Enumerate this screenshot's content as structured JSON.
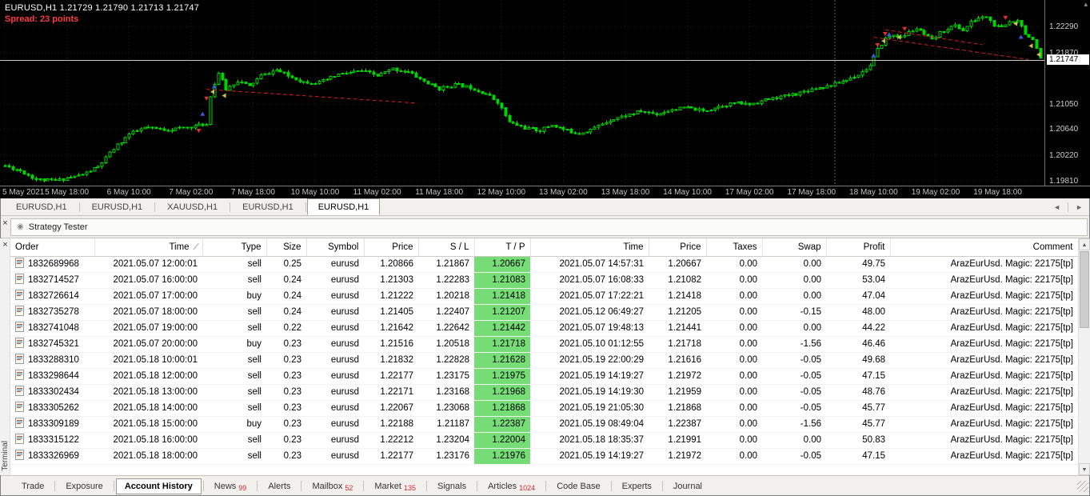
{
  "chart": {
    "title": "EURUSD,H1",
    "ohlc_text": "EURUSD,H1 1.21729 1.21790 1.21713 1.21747",
    "spread_text": "Spread: 23 points",
    "current_price": "1.21747",
    "scroll_marker": "▴",
    "price_axis_labels": [
      {
        "text": "1.22290",
        "value": 1.2229
      },
      {
        "text": "1.21870",
        "value": 1.2187
      },
      {
        "text": "1.21050",
        "value": 1.2105
      },
      {
        "text": "1.20640",
        "value": 1.2064
      },
      {
        "text": "1.20220",
        "value": 1.2022
      },
      {
        "text": "1.19810",
        "value": 1.1981
      }
    ],
    "time_axis_labels": [
      "5 May 2021",
      "5 May 18:00",
      "6 May 10:00",
      "7 May 02:00",
      "7 May 18:00",
      "10 May 10:00",
      "11 May 02:00",
      "11 May 18:00",
      "12 May 10:00",
      "13 May 02:00",
      "13 May 18:00",
      "14 May 10:00",
      "17 May 02:00",
      "17 May 18:00",
      "18 May 10:00",
      "19 May 02:00",
      "19 May 18:00"
    ],
    "chart_data": {
      "type": "candlestick",
      "symbol": "EURUSD",
      "period": "H1",
      "candle_count": 268,
      "price_top": 1.2272,
      "price_bottom": 1.1973,
      "bid_price": 1.21747,
      "up_color": "#00d400",
      "down_color": "#00d400",
      "background": "#000000",
      "seed": 11,
      "jitter": 0.0005,
      "waypoints": [
        [
          0,
          1.2005
        ],
        [
          4,
          1.1997
        ],
        [
          8,
          1.1983
        ],
        [
          13,
          1.1981
        ],
        [
          16,
          1.1985
        ],
        [
          20,
          1.1991
        ],
        [
          24,
          1.2003
        ],
        [
          28,
          1.2032
        ],
        [
          32,
          1.2056
        ],
        [
          36,
          1.2066
        ],
        [
          42,
          1.2063
        ],
        [
          48,
          1.2068
        ],
        [
          52,
          1.2072
        ],
        [
          53,
          1.2118
        ],
        [
          55,
          1.2155
        ],
        [
          57,
          1.2128
        ],
        [
          60,
          1.2142
        ],
        [
          63,
          1.2133
        ],
        [
          66,
          1.215
        ],
        [
          70,
          1.2159
        ],
        [
          73,
          1.215
        ],
        [
          77,
          1.214
        ],
        [
          81,
          1.2139
        ],
        [
          86,
          1.2152
        ],
        [
          92,
          1.2158
        ],
        [
          96,
          1.215
        ],
        [
          100,
          1.2161
        ],
        [
          104,
          1.2156
        ],
        [
          108,
          1.2141
        ],
        [
          112,
          1.2129
        ],
        [
          116,
          1.2136
        ],
        [
          120,
          1.2131
        ],
        [
          124,
          1.2121
        ],
        [
          127,
          1.2108
        ],
        [
          130,
          1.2075
        ],
        [
          134,
          1.2066
        ],
        [
          138,
          1.2062
        ],
        [
          141,
          1.2071
        ],
        [
          144,
          1.2063
        ],
        [
          148,
          1.2057
        ],
        [
          152,
          1.2066
        ],
        [
          156,
          1.2079
        ],
        [
          160,
          1.2086
        ],
        [
          164,
          1.2093
        ],
        [
          168,
          1.2088
        ],
        [
          172,
          1.2096
        ],
        [
          176,
          1.2098
        ],
        [
          180,
          1.2093
        ],
        [
          184,
          1.2101
        ],
        [
          188,
          1.2106
        ],
        [
          192,
          1.2104
        ],
        [
          196,
          1.2111
        ],
        [
          200,
          1.2116
        ],
        [
          204,
          1.2121
        ],
        [
          208,
          1.2129
        ],
        [
          212,
          1.2133
        ],
        [
          216,
          1.2141
        ],
        [
          220,
          1.2152
        ],
        [
          223,
          1.2166
        ],
        [
          225,
          1.2192
        ],
        [
          227,
          1.221
        ],
        [
          229,
          1.2216
        ],
        [
          231,
          1.2211
        ],
        [
          233,
          1.222
        ],
        [
          235,
          1.2226
        ],
        [
          237,
          1.2216
        ],
        [
          239,
          1.2207
        ],
        [
          241,
          1.2219
        ],
        [
          243,
          1.2226
        ],
        [
          245,
          1.2231
        ],
        [
          247,
          1.2223
        ],
        [
          249,
          1.2236
        ],
        [
          251,
          1.2243
        ],
        [
          253,
          1.2245
        ],
        [
          255,
          1.2231
        ],
        [
          257,
          1.2227
        ],
        [
          259,
          1.2237
        ],
        [
          261,
          1.2241
        ],
        [
          263,
          1.2219
        ],
        [
          265,
          1.2206
        ],
        [
          266,
          1.2192
        ],
        [
          267,
          1.2176
        ]
      ],
      "vline_candle": 214,
      "trendlines": [
        {
          "c1": 52,
          "p1": 1.2128,
          "c2": 106,
          "p2": 1.2106
        },
        {
          "c1": 224,
          "p1": 1.2212,
          "c2": 264,
          "p2": 1.2176
        },
        {
          "c1": 227,
          "p1": 1.2224,
          "c2": 252,
          "p2": 1.22
        }
      ],
      "markers": [
        {
          "c": 50,
          "p": 1.2058,
          "color": "#e03030",
          "dir": "down"
        },
        {
          "c": 51,
          "p": 1.2092,
          "color": "#3b5bdd",
          "dir": "up"
        },
        {
          "c": 52,
          "p": 1.211,
          "color": "#e03030",
          "dir": "down"
        },
        {
          "c": 53,
          "p": 1.2124,
          "color": "#cfc04a",
          "dir": "left"
        },
        {
          "c": 54,
          "p": 1.2136,
          "color": "#3b5bdd",
          "dir": "up"
        },
        {
          "c": 56,
          "p": 1.2118,
          "color": "#cfc04a",
          "dir": "left"
        },
        {
          "c": 224,
          "p": 1.2186,
          "color": "#3b5bdd",
          "dir": "up"
        },
        {
          "c": 225,
          "p": 1.2196,
          "color": "#e03030",
          "dir": "down"
        },
        {
          "c": 226,
          "p": 1.2206,
          "color": "#cfc04a",
          "dir": "left"
        },
        {
          "c": 227,
          "p": 1.2214,
          "color": "#e03030",
          "dir": "down"
        },
        {
          "c": 228,
          "p": 1.222,
          "color": "#3b5bdd",
          "dir": "up"
        },
        {
          "c": 230,
          "p": 1.2212,
          "color": "#cfc04a",
          "dir": "left"
        },
        {
          "c": 232,
          "p": 1.2222,
          "color": "#e03030",
          "dir": "down"
        },
        {
          "c": 258,
          "p": 1.224,
          "color": "#e03030",
          "dir": "down"
        },
        {
          "c": 260,
          "p": 1.2234,
          "color": "#cfc04a",
          "dir": "left"
        },
        {
          "c": 262,
          "p": 1.2216,
          "color": "#3b5bdd",
          "dir": "up"
        },
        {
          "c": 264,
          "p": 1.2198,
          "color": "#cfc04a",
          "dir": "left"
        },
        {
          "c": 266,
          "p": 1.2184,
          "color": "#cfc04a",
          "dir": "left"
        }
      ]
    }
  },
  "chart_tabs": {
    "tabs": [
      {
        "label": "EURUSD,H1",
        "active": false
      },
      {
        "label": "EURUSD,H1",
        "active": false
      },
      {
        "label": "XAUUSD,H1",
        "active": false
      },
      {
        "label": "EURUSD,H1",
        "active": false
      },
      {
        "label": "EURUSD,H1",
        "active": true
      }
    ],
    "scroll_left": "◄",
    "scroll_right": "►"
  },
  "tester": {
    "close_glyph": "×",
    "icon_glyph": "◉",
    "title": "Strategy Tester"
  },
  "terminal": {
    "close_glyph": "×",
    "side_label": "Terminal",
    "scrollbar": {
      "up": "▲",
      "down": "▼"
    },
    "history": {
      "columns": [
        "Order",
        "Time",
        "Type",
        "Size",
        "Symbol",
        "Price",
        "S / L",
        "T / P",
        "Time",
        "Price",
        "Taxes",
        "Swap",
        "Profit",
        "Comment"
      ],
      "sort_column": 1,
      "sort_glyph": "∕",
      "rows": [
        [
          "1832689968",
          "2021.05.07 12:00:01",
          "sell",
          "0.25",
          "eurusd",
          "1.20866",
          "1.21867",
          "1.20667",
          "2021.05.07 14:57:31",
          "1.20667",
          "0.00",
          "0.00",
          "49.75",
          "ArazEurUsd. Magic: 22175[tp]"
        ],
        [
          "1832714527",
          "2021.05.07 16:00:00",
          "sell",
          "0.24",
          "eurusd",
          "1.21303",
          "1.22283",
          "1.21083",
          "2021.05.07 16:08:33",
          "1.21082",
          "0.00",
          "0.00",
          "53.04",
          "ArazEurUsd. Magic: 22175[tp]"
        ],
        [
          "1832726614",
          "2021.05.07 17:00:00",
          "buy",
          "0.24",
          "eurusd",
          "1.21222",
          "1.20218",
          "1.21418",
          "2021.05.07 17:22:21",
          "1.21418",
          "0.00",
          "0.00",
          "47.04",
          "ArazEurUsd. Magic: 22175[tp]"
        ],
        [
          "1832735278",
          "2021.05.07 18:00:00",
          "sell",
          "0.24",
          "eurusd",
          "1.21405",
          "1.22407",
          "1.21207",
          "2021.05.12 06:49:27",
          "1.21205",
          "0.00",
          "-0.15",
          "48.00",
          "ArazEurUsd. Magic: 22175[tp]"
        ],
        [
          "1832741048",
          "2021.05.07 19:00:00",
          "sell",
          "0.22",
          "eurusd",
          "1.21642",
          "1.22642",
          "1.21442",
          "2021.05.07 19:48:13",
          "1.21441",
          "0.00",
          "0.00",
          "44.22",
          "ArazEurUsd. Magic: 22175[tp]"
        ],
        [
          "1832745321",
          "2021.05.07 20:00:00",
          "buy",
          "0.23",
          "eurusd",
          "1.21516",
          "1.20518",
          "1.21718",
          "2021.05.10 01:12:55",
          "1.21718",
          "0.00",
          "-1.56",
          "46.46",
          "ArazEurUsd. Magic: 22175[tp]"
        ],
        [
          "1833288310",
          "2021.05.18 10:00:01",
          "sell",
          "0.23",
          "eurusd",
          "1.21832",
          "1.22828",
          "1.21628",
          "2021.05.19 22:00:29",
          "1.21616",
          "0.00",
          "-0.05",
          "49.68",
          "ArazEurUsd. Magic: 22175[tp]"
        ],
        [
          "1833298644",
          "2021.05.18 12:00:00",
          "sell",
          "0.23",
          "eurusd",
          "1.22177",
          "1.23175",
          "1.21975",
          "2021.05.19 14:19:27",
          "1.21972",
          "0.00",
          "-0.05",
          "47.15",
          "ArazEurUsd. Magic: 22175[tp]"
        ],
        [
          "1833302434",
          "2021.05.18 13:00:00",
          "sell",
          "0.23",
          "eurusd",
          "1.22171",
          "1.23168",
          "1.21968",
          "2021.05.19 14:19:30",
          "1.21959",
          "0.00",
          "-0.05",
          "48.76",
          "ArazEurUsd. Magic: 22175[tp]"
        ],
        [
          "1833305262",
          "2021.05.18 14:00:00",
          "sell",
          "0.23",
          "eurusd",
          "1.22067",
          "1.23068",
          "1.21868",
          "2021.05.19 21:05:30",
          "1.21868",
          "0.00",
          "-0.05",
          "45.77",
          "ArazEurUsd. Magic: 22175[tp]"
        ],
        [
          "1833309189",
          "2021.05.18 15:00:00",
          "buy",
          "0.23",
          "eurusd",
          "1.22188",
          "1.21187",
          "1.22387",
          "2021.05.19 08:49:04",
          "1.22387",
          "0.00",
          "-1.56",
          "45.77",
          "ArazEurUsd. Magic: 22175[tp]"
        ],
        [
          "1833315122",
          "2021.05.18 16:00:00",
          "sell",
          "0.23",
          "eurusd",
          "1.22212",
          "1.23204",
          "1.22004",
          "2021.05.18 18:35:37",
          "1.21991",
          "0.00",
          "0.00",
          "50.83",
          "ArazEurUsd. Magic: 22175[tp]"
        ],
        [
          "1833326969",
          "2021.05.18 18:00:00",
          "sell",
          "0.23",
          "eurusd",
          "1.22177",
          "1.23176",
          "1.21976",
          "2021.05.19 14:19:27",
          "1.21972",
          "0.00",
          "-0.05",
          "47.15",
          "ArazEurUsd. Magic: 22175[tp]"
        ]
      ]
    },
    "tabs": [
      {
        "label": "Trade"
      },
      {
        "label": "Exposure"
      },
      {
        "label": "Account History",
        "active": true
      },
      {
        "label": "News",
        "count": "99"
      },
      {
        "label": "Alerts"
      },
      {
        "label": "Mailbox",
        "count": "52"
      },
      {
        "label": "Market",
        "count": "135"
      },
      {
        "label": "Signals"
      },
      {
        "label": "Articles",
        "count": "1024"
      },
      {
        "label": "Code Base"
      },
      {
        "label": "Experts"
      },
      {
        "label": "Journal"
      }
    ]
  }
}
